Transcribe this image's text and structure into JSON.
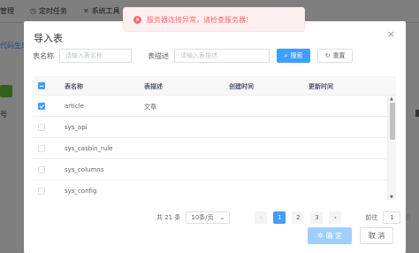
{
  "background": {
    "tabs": [
      {
        "label": "管理",
        "icon": ""
      },
      {
        "label": "定时任务",
        "icon": "clock-icon"
      },
      {
        "label": "系统工具",
        "icon": "tools-icon"
      }
    ],
    "link_text": "代码生成",
    "column_text": "号"
  },
  "toast": {
    "message": "服务器连接异常，请检查服务器!",
    "icon": "error-circle-icon",
    "color": "#f56c6c"
  },
  "dialog": {
    "title": "导入表",
    "close_icon": "×",
    "search": {
      "name_label": "表名称",
      "name_placeholder": "请输入表名称",
      "desc_label": "表描述",
      "desc_placeholder": "请输入表描述",
      "search_button": "搜索",
      "reset_button": "重置"
    },
    "table": {
      "headers": [
        "表名称",
        "表描述",
        "创建时间",
        "更新时间"
      ],
      "rows": [
        {
          "name": "article",
          "desc": "文章",
          "created": "",
          "updated": "",
          "checked": true
        },
        {
          "name": "sys_api",
          "desc": "",
          "created": "",
          "updated": "",
          "checked": false
        },
        {
          "name": "sys_casbin_rule",
          "desc": "",
          "created": "",
          "updated": "",
          "checked": false
        },
        {
          "name": "sys_columns",
          "desc": "",
          "created": "",
          "updated": "",
          "checked": false
        },
        {
          "name": "sys_config",
          "desc": "",
          "created": "",
          "updated": "",
          "checked": false
        }
      ]
    },
    "pagination": {
      "total_text": "共 21 条",
      "page_size": "10条/页",
      "prev": "‹",
      "next": "›",
      "pages": [
        "1",
        "2",
        "3"
      ],
      "current_page": "1",
      "goto_label": "前往",
      "goto_value": "1",
      "goto_unit": "页"
    },
    "footer": {
      "ok_label": "确 定",
      "cancel_label": "取 消"
    }
  },
  "colors": {
    "primary": "#409eff",
    "primary_disabled": "#a0cfff",
    "danger": "#f56c6c"
  }
}
